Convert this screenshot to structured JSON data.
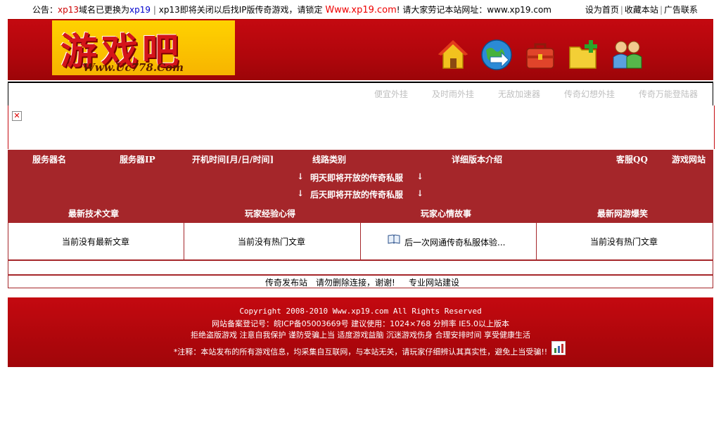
{
  "notice": {
    "prefix": "公告：",
    "old_domain": "xp13",
    "changed_text": "域名已更换为",
    "new_domain": "xp19",
    "sep": "|",
    "closing_text": " xp13即将关闭以后找IP版传奇游戏，请锁定 ",
    "site_url": "Www.xp19.com",
    "remember_text": "! 请大家劳记本站网址：www.xp19.com"
  },
  "toplinks": {
    "home": "设为首页",
    "favorite": "收藏本站",
    "ad": "广告联系",
    "sep": "|"
  },
  "logo": {
    "text": "游戏吧",
    "url": "Www.Uc778.Com"
  },
  "header_icons": [
    "home-icon",
    "globe-arrow-icon",
    "briefcase-icon",
    "folder-add-icon",
    "users-icon"
  ],
  "menu": {
    "items": [
      "便宜外挂",
      "及时雨外挂",
      "无敌加速器",
      "传奇幻想外挂",
      "传奇万能登陆器"
    ]
  },
  "server_table": {
    "headers": [
      "服务器名",
      "服务器IP",
      "开机时间[月/日/时间]",
      "线路类别",
      "详细版本介绍",
      "客服QQ",
      "游戏网站"
    ],
    "tomorrow": "明天即将开放的传奇私服",
    "day_after": "后天即将开放的传奇私服",
    "arrow": "↓"
  },
  "sections": {
    "headers": [
      "最新技术文章",
      "玩家经验心得",
      "玩家心情故事",
      "最新网游爆笑"
    ],
    "cells": [
      "当前没有最新文章",
      "当前没有热门文章",
      "后一次网通传奇私服体验...",
      "当前没有热门文章"
    ]
  },
  "bottom_bar": {
    "a": "传奇发布站",
    "b": "请勿删除连接，谢谢!",
    "c": "专业网站建设"
  },
  "footer": {
    "copyright": "Copyright 2008-2010 Www.xp19.com All Rights Reserved",
    "icp": "网站备案登记号：皖ICP备05003669号 建议使用：1024×768 分辨率  IE5.0以上版本",
    "health": "拒绝盗版游戏 注意自我保护 谨防受骗上当 适度游戏益脑 沉迷游戏伤身 合理安排时间 享受健康生活",
    "disclaimer": "*注释：本站发布的所有游戏信息，均采集自互联网，与本站无关，请玩家仔细辨认其真实性，避免上当受骗!!"
  },
  "colors": {
    "header_red": "#c40910",
    "table_red": "#a5262a",
    "logo_yellow": "#ffd200"
  }
}
